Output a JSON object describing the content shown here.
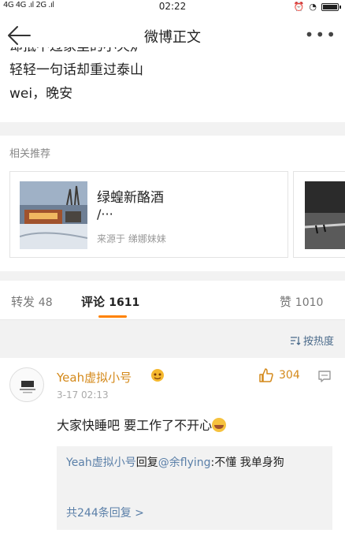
{
  "status": {
    "signal": "4G 4G .ıl 2G .ıl",
    "time": "02:22"
  },
  "header": {
    "title": "微博正文"
  },
  "post": {
    "lines": [
      "却抵不过家里的小火炉",
      "轻轻一句话却重过泰山",
      "wei，晚安"
    ]
  },
  "related": {
    "header": "相关推荐",
    "card": {
      "title": "绿蝗新酪酒",
      "subtitle": "/···",
      "source": "来源于 绨娜妹妹"
    }
  },
  "tabs": {
    "repost_label": "转发",
    "repost_count": "48",
    "comment_label": "评论",
    "comment_count": "1611",
    "like_label": "赞",
    "like_count": "1010"
  },
  "sort": {
    "label": "按热度"
  },
  "comment": {
    "username": "Yeah虚拟小号",
    "time": "3-17 02:13",
    "likes": "304",
    "text": "大家快睡吧 要工作了不开心",
    "reply": {
      "name": "Yeah虚拟小号",
      "verb": "回复",
      "mention": "@余flying",
      "text": ":不懂 我单身狗"
    },
    "more_replies": "共244条回复 >"
  },
  "colors": {
    "accent": "#ff8200",
    "username": "#d4891a",
    "link": "#5a7fa8"
  }
}
